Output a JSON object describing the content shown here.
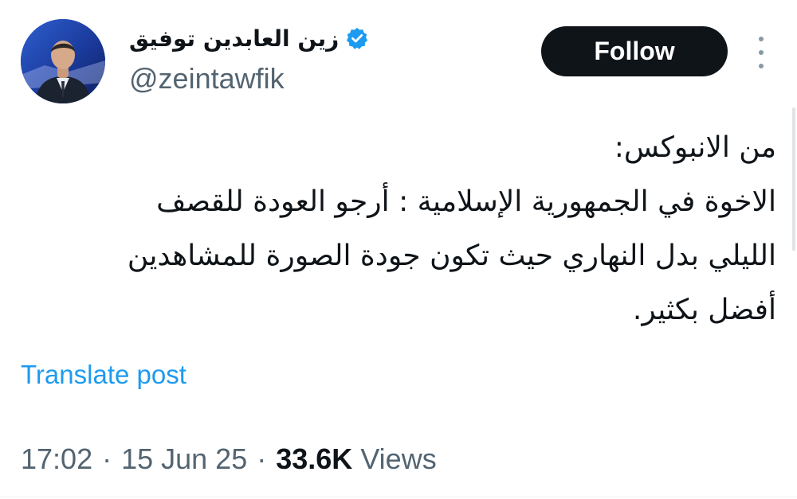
{
  "author": {
    "display_name": "زين العابدين توفيق",
    "handle": "@zeintawfik",
    "verified": true
  },
  "actions": {
    "follow_label": "Follow",
    "more_icon": "more-vertical-icon"
  },
  "tweet": {
    "lines": [
      "من الانبوكس:",
      "الاخوة في الجمهورية الإسلامية : أرجو العودة للقصف",
      "الليلي بدل النهاري حيث تكون جودة الصورة للمشاهدين",
      "أفضل بكثير."
    ],
    "translate_label": "Translate post"
  },
  "meta": {
    "time": "17:02",
    "separator": "·",
    "date": "15 Jun 25",
    "views_count": "33.6K",
    "views_label": "Views"
  },
  "colors": {
    "text": "#0f1419",
    "muted": "#536471",
    "link": "#1d9bf0",
    "verified_badge": "#1d9bf0",
    "button_bg": "#0f1419"
  }
}
